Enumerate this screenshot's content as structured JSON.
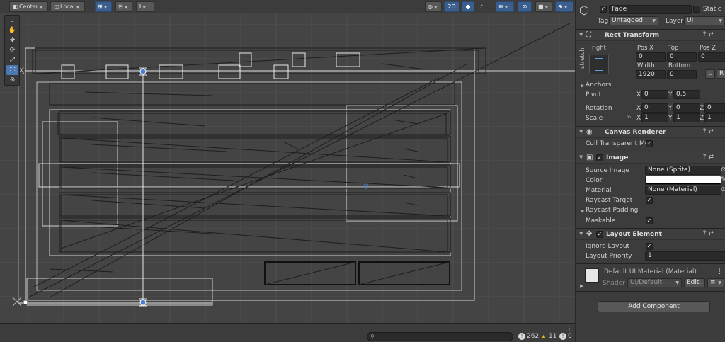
{
  "scene_toolbar": {
    "pivot_mode": "Center",
    "pivot_rotation": "Local",
    "mode_2d": "2D"
  },
  "tools": [
    "hand-tool-icon",
    "move-tool-icon",
    "rotate-tool-icon",
    "scale-tool-icon",
    "rect-tool-icon",
    "transform-tool-icon"
  ],
  "console": {
    "search_placeholder": "",
    "log_count": "262",
    "warning_count": "11",
    "error_count": "0"
  },
  "inspector": {
    "object_name": "Fade",
    "active": true,
    "static_label": "Static",
    "tag_label": "Tag",
    "tag_value": "Untagged",
    "layer_label": "Layer",
    "layer_value": "UI",
    "rect_transform": {
      "title": "Rect Transform",
      "anchor_h": "right",
      "anchor_v": "stretch",
      "pos_x_label": "Pos X",
      "top_label": "Top",
      "pos_z_label": "Pos Z",
      "pos_x": "0",
      "top": "0",
      "pos_z": "0",
      "width_label": "Width",
      "bottom_label": "Bottom",
      "width": "1920",
      "bottom": "0",
      "anchors_label": "Anchors",
      "pivot_label": "Pivot",
      "pivot_x": "0",
      "pivot_y": "0.5",
      "rotation_label": "Rotation",
      "rot_x": "0",
      "rot_y": "0",
      "rot_z": "0",
      "scale_label": "Scale",
      "scale_x": "1",
      "scale_y": "1",
      "scale_z": "1"
    },
    "canvas_renderer": {
      "title": "Canvas Renderer",
      "cull_label": "Cull Transparent Mes",
      "cull": true
    },
    "image": {
      "title": "Image",
      "source_label": "Source Image",
      "source_value": "None (Sprite)",
      "color_label": "Color",
      "color_value": "#ffffff",
      "material_label": "Material",
      "material_value": "None (Material)",
      "raycast_target_label": "Raycast Target",
      "raycast_padding_label": "Raycast Padding",
      "maskable_label": "Maskable"
    },
    "layout_element": {
      "title": "Layout Element",
      "ignore_layout_label": "Ignore Layout",
      "priority_label": "Layout Priority",
      "priority_value": "1"
    },
    "material_preview": {
      "name": "Default UI Material (Material)",
      "shader_label": "Shader",
      "shader_value": "UI/Default",
      "edit_label": "Edit..."
    },
    "add_component": "Add Component"
  },
  "colors": {
    "scene_bg": "#444444",
    "accent": "#4b78b0",
    "inspector_bg": "#3c3c3c"
  }
}
